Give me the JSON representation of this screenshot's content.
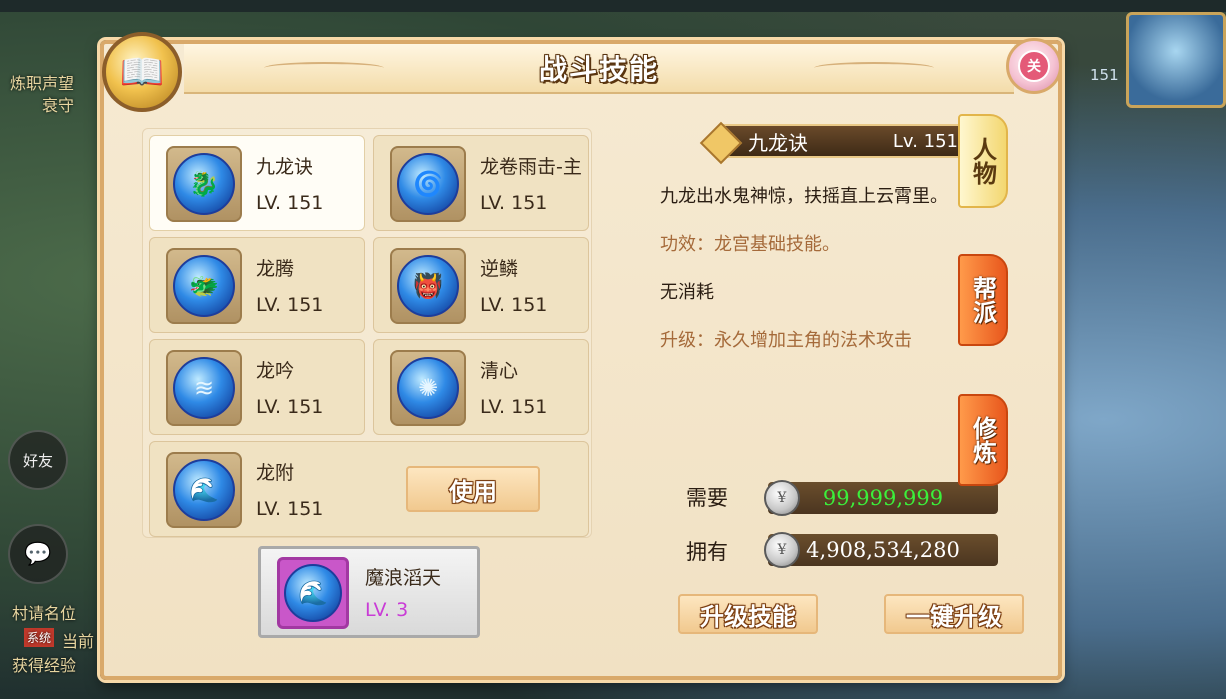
{
  "scene": {
    "top_left_text1": "炼职声望",
    "top_left_text2": "衰守",
    "left_chat_label": "好友",
    "bottom_left_lines": [
      "村请名位",
      "当前",
      "获得经验"
    ],
    "bottom_left_badge": "系统",
    "right_level": "151"
  },
  "panel": {
    "title": "战斗技能",
    "close_label": "关"
  },
  "skills": [
    {
      "name": "九龙诀",
      "level": "LV. 151",
      "icon": "dragon-swirl-icon"
    },
    {
      "name": "龙卷雨击-主",
      "level": "LV. 151",
      "icon": "tornado-icon"
    },
    {
      "name": "龙腾",
      "level": "LV. 151",
      "icon": "dragon-rise-icon"
    },
    {
      "name": "逆鳞",
      "level": "LV. 151",
      "icon": "dragon-face-icon"
    },
    {
      "name": "龙吟",
      "level": "LV. 151",
      "icon": "dragon-roar-icon"
    },
    {
      "name": "清心",
      "level": "LV. 151",
      "icon": "clear-heart-icon"
    },
    {
      "name": "龙附",
      "level": "LV. 151",
      "icon": "wave-icon"
    }
  ],
  "use_button": "使用",
  "special_skill": {
    "name": "魔浪滔天",
    "level": "LV. 3"
  },
  "detail": {
    "name": "九龙诀",
    "level": "Lv. 151",
    "description": "九龙出水鬼神惊，扶摇直上云霄里。",
    "effect": "功效：龙宫基础技能。",
    "cost": "无消耗",
    "upgrade": "升级：永久增加主角的法术攻击"
  },
  "costs": {
    "need_label": "需要",
    "need_value": "99,999,999",
    "have_label": "拥有",
    "have_value": "4,908,534,280"
  },
  "buttons": {
    "upgrade": "升级技能",
    "one_click": "一键升级"
  },
  "tabs": [
    "人物",
    "帮派",
    "修炼"
  ],
  "colors": {
    "need_value": "#3bf03b",
    "special_level": "#c93cd6",
    "tab_active": "#f3d770",
    "tab_normal": "#e8571d"
  }
}
